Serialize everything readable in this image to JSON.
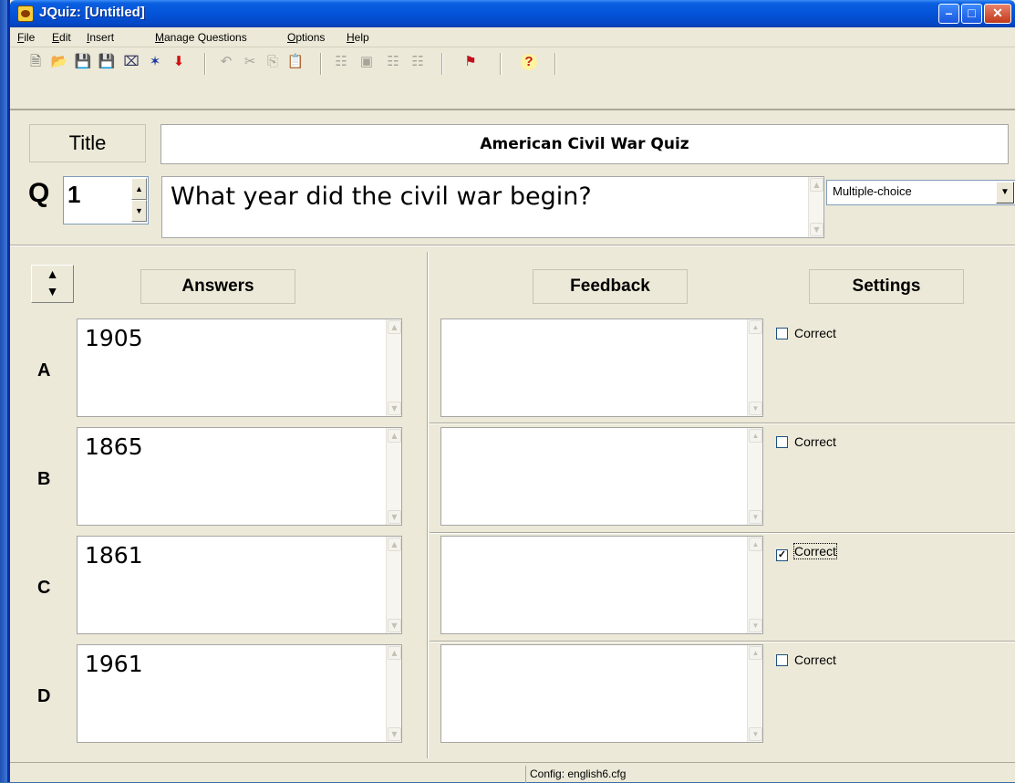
{
  "window": {
    "title": "JQuiz: [Untitled]",
    "min": "–",
    "max": "□",
    "close": "✕"
  },
  "menu": [
    {
      "label": "File",
      "key": "F"
    },
    {
      "label": "Edit",
      "key": "E"
    },
    {
      "label": "Insert",
      "key": "I"
    },
    {
      "label": "Manage Questions",
      "key": "M"
    },
    {
      "label": "Options",
      "key": "O"
    },
    {
      "label": "Help",
      "key": "H"
    }
  ],
  "toolbar": {
    "icons": [
      "new-file-icon",
      "open-folder-icon",
      "save-icon",
      "save-as-icon",
      "eraser-icon",
      "web-export-icon",
      "arrow-down-icon",
      "undo-icon",
      "cut-icon",
      "copy-icon",
      "paste-icon",
      "add-question-icon",
      "insert-image-icon",
      "reading-icon",
      "delete-question-icon",
      "flag-icon",
      "help-icon"
    ],
    "glyphs": {
      "new": "🗎",
      "open": "📂",
      "save": "💾",
      "save_as": "💾",
      "eraser": "⌧",
      "web": "✶",
      "down": "⬇",
      "undo": "↶",
      "cut": "✂",
      "copy": "⎘",
      "paste": "📋",
      "q1": "☷",
      "q2": "▣",
      "q3": "☷",
      "q4": "☷",
      "flag": "⚑",
      "help": "?"
    }
  },
  "quiz": {
    "title_button": "Title",
    "title": "American Civil War Quiz",
    "q_label": "Q",
    "question_number": "1",
    "question_text": "What year did the civil war begin?",
    "question_type": "Multiple-choice"
  },
  "columns": {
    "answers": "Answers",
    "feedback": "Feedback",
    "settings": "Settings"
  },
  "rows": [
    {
      "letter": "A",
      "answer": "1905",
      "feedback": "",
      "correct_label": "Correct",
      "correct": false
    },
    {
      "letter": "B",
      "answer": "1865",
      "feedback": "",
      "correct_label": "Correct",
      "correct": false
    },
    {
      "letter": "C",
      "answer": "1861",
      "feedback": "",
      "correct_label": "Correct",
      "correct": true
    },
    {
      "letter": "D",
      "answer": "1961",
      "feedback": "",
      "correct_label": "Correct",
      "correct": false
    }
  ],
  "status": {
    "config": "Config: english6.cfg"
  },
  "colors": {
    "titlebar": "#0454d8",
    "face": "#ece9d8",
    "desktop": "#3a6ea5"
  }
}
